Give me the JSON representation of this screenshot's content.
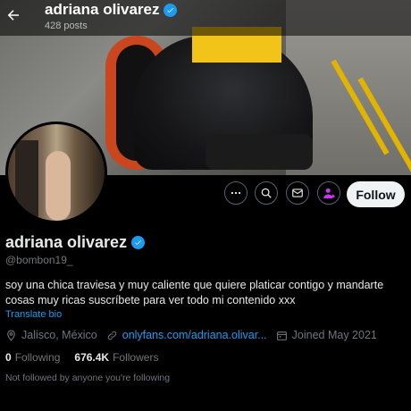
{
  "header": {
    "display_name": "adriana olivarez",
    "post_count": "428 posts"
  },
  "profile": {
    "display_name": "adriana olivarez",
    "handle": "@bombon19_",
    "bio": "soy una chica traviesa y muy caliente que quiere platicar contigo y mandarte cosas muy ricas suscríbete para ver todo mi contenido xxx",
    "translate_label": "Translate bio",
    "location": "Jalisco, México",
    "website": "onlyfans.com/adriana.olivar...",
    "joined": "Joined May 2021",
    "following_count": "0",
    "following_label": "Following",
    "followers_count": "676.4K",
    "followers_label": "Followers",
    "not_followed_text": "Not followed by anyone you're following"
  },
  "actions": {
    "follow_label": "Follow"
  },
  "colors": {
    "accent": "#1d9bf0",
    "subscribe_icon": "#c936f3",
    "background": "#000000"
  },
  "icons": [
    "back-arrow-icon",
    "verified-badge-icon",
    "more-icon",
    "search-icon",
    "message-icon",
    "subscribe-icon",
    "location-icon",
    "link-icon",
    "calendar-icon"
  ]
}
